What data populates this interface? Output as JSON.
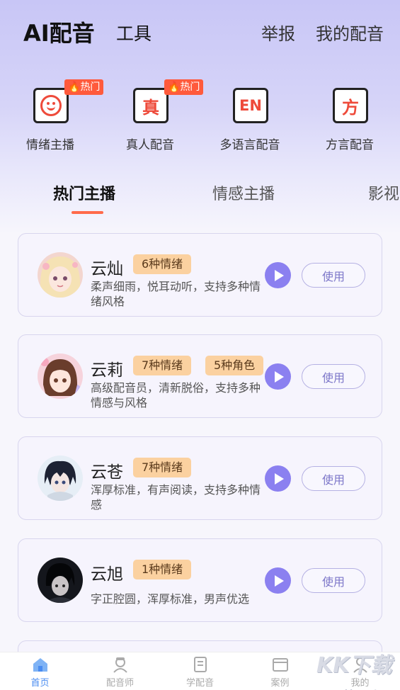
{
  "header": {
    "title": "AI配音",
    "tools": "工具",
    "report": "举报",
    "my_dubbing": "我的配音"
  },
  "categories": [
    {
      "label": "情绪主播",
      "icon": "smiley-face-icon",
      "badge": "热门"
    },
    {
      "label": "真人配音",
      "icon": "zhen-char-icon",
      "glyph": "真",
      "badge": "热门"
    },
    {
      "label": "多语言配音",
      "icon": "en-language-icon",
      "glyph": "EN"
    },
    {
      "label": "方言配音",
      "icon": "fang-char-icon",
      "glyph": "方"
    }
  ],
  "tabs": [
    "热门主播",
    "情感主播",
    "影视"
  ],
  "anchors": [
    {
      "name": "云灿",
      "tags": [
        "6种情绪"
      ],
      "desc": "柔声细雨，悦耳动听，支持多种情绪风格",
      "button": "使用"
    },
    {
      "name": "云莉",
      "tags": [
        "7种情绪",
        "5种角色"
      ],
      "desc": "高级配音员，清新脱俗，支持多种情感与风格",
      "button": "使用"
    },
    {
      "name": "云苍",
      "tags": [
        "7种情绪"
      ],
      "desc": "浑厚标准，有声阅读，支持多种情感",
      "button": "使用"
    },
    {
      "name": "云旭",
      "tags": [
        "1种情绪"
      ],
      "desc": "字正腔圆，浑厚标准，男声优选",
      "button": "使用"
    }
  ],
  "bottom_nav": [
    {
      "label": "首页",
      "icon": "home-icon",
      "active": true
    },
    {
      "label": "配音师",
      "icon": "voice-actor-icon"
    },
    {
      "label": "学配音",
      "icon": "book-icon"
    },
    {
      "label": "案例",
      "icon": "case-icon"
    },
    {
      "label": "我的",
      "icon": "profile-icon"
    }
  ],
  "watermark": {
    "text": "KK下载",
    "url": "www.kkx.net"
  },
  "colors": {
    "accent": "#8b80f0",
    "badge": "#ff5a3c",
    "tag_bg": "#fbd1a0",
    "active_nav": "#4a8cf0"
  }
}
